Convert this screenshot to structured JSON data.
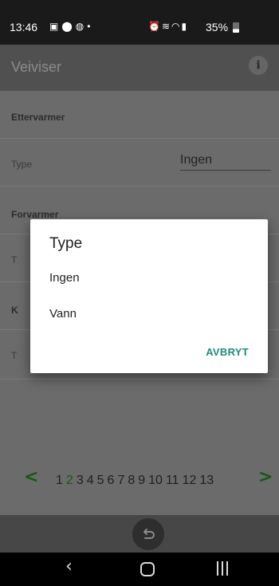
{
  "status": {
    "time": "13:46",
    "notification_icons": [
      "image-icon",
      "location-icon",
      "messenger-icon",
      "dot-icon"
    ],
    "system_icons": [
      "alarm-icon",
      "wifi-calling-icon",
      "wifi-icon",
      "signal-icon"
    ],
    "battery": "35%",
    "battery_level": 0.35
  },
  "appbar": {
    "title": "Veiviser",
    "info_symbol": "i"
  },
  "content": {
    "sections": [
      {
        "header": "Ettervarmer",
        "field_label": "Type",
        "field_value": "Ingen"
      },
      {
        "header": "Forvarmer",
        "field_label": "T",
        "field_value": ""
      },
      {
        "header": "K",
        "field_label": "T",
        "field_value": ""
      }
    ]
  },
  "pager": {
    "prev": "<",
    "next": ">",
    "pages": [
      "1",
      "2",
      "3",
      "4",
      "5",
      "6",
      "7",
      "8",
      "9",
      "10",
      "11",
      "12",
      "13"
    ],
    "current": "2"
  },
  "dialog": {
    "title": "Type",
    "options": [
      "Ingen",
      "Vann"
    ],
    "cancel_label": "AVBRYT"
  },
  "colors": {
    "accent": "#1f8c7a",
    "pager_green": "#145a14"
  }
}
